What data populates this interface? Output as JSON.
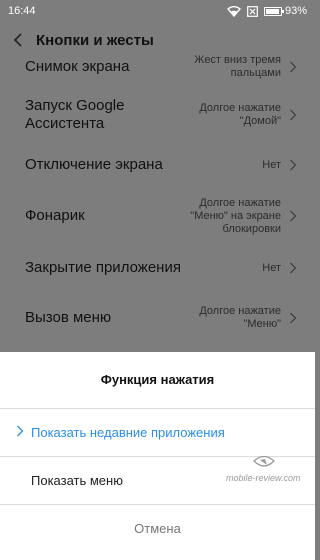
{
  "status_bar": {
    "time": "16:44",
    "battery": "93%",
    "icons": [
      "wifi-icon",
      "sim-x-icon",
      "battery-icon"
    ]
  },
  "header": {
    "title": "Кнопки и жесты",
    "back_icon": "back-arrow-icon"
  },
  "settings": {
    "items": [
      {
        "label": "Снимок экрана",
        "value": "Жест вниз тремя пальцами"
      },
      {
        "label": "Запуск Google Ассистента",
        "value": "Долгое нажатие \"Домой\""
      },
      {
        "label": "Отключение экрана",
        "value": "Нет"
      },
      {
        "label": "Фонарик",
        "value": "Долгое нажатие \"Меню\" на экране блокировки"
      },
      {
        "label": "Закрытие приложения",
        "value": "Нет"
      },
      {
        "label": "Вызов меню",
        "value": "Долгое нажатие \"Меню\""
      }
    ]
  },
  "dialog": {
    "title": "Функция нажатия",
    "options": [
      {
        "label": "Показать недавние приложения",
        "selected": true
      },
      {
        "label": "Показать меню",
        "selected": false
      }
    ],
    "cancel_label": "Отмена"
  },
  "watermark": {
    "text": "mobile-review.com"
  },
  "colors": {
    "dim_background": "#7d7d7d",
    "accent": "#2b8ee6",
    "sheet_background": "#ffffff"
  }
}
